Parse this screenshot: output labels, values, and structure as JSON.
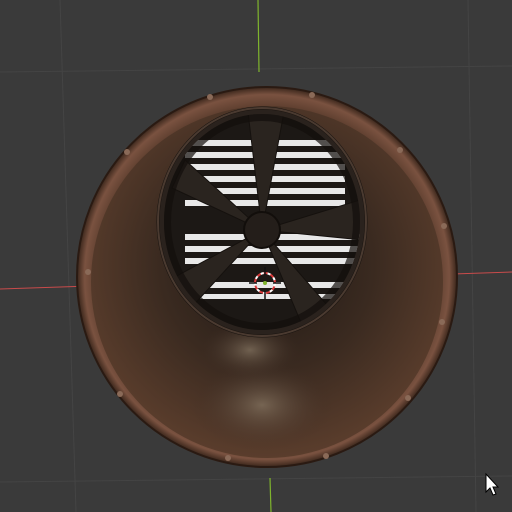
{
  "viewport": {
    "background_color": "#3a3a3a",
    "grid_color": "#444444",
    "x_axis_color": "#c84b4b",
    "y_axis_color": "#7fb42d"
  },
  "model": {
    "rim_color": "#5e3f2e",
    "inner_wall_color": "#3e2b22",
    "blade_color": "#2a241f",
    "vent_color": "#e8e8e8"
  },
  "gizmo": {
    "icon": "3d-cursor-icon",
    "ring_color": "#d8393a"
  },
  "cursor": {
    "icon": "mouse-pointer-icon"
  }
}
